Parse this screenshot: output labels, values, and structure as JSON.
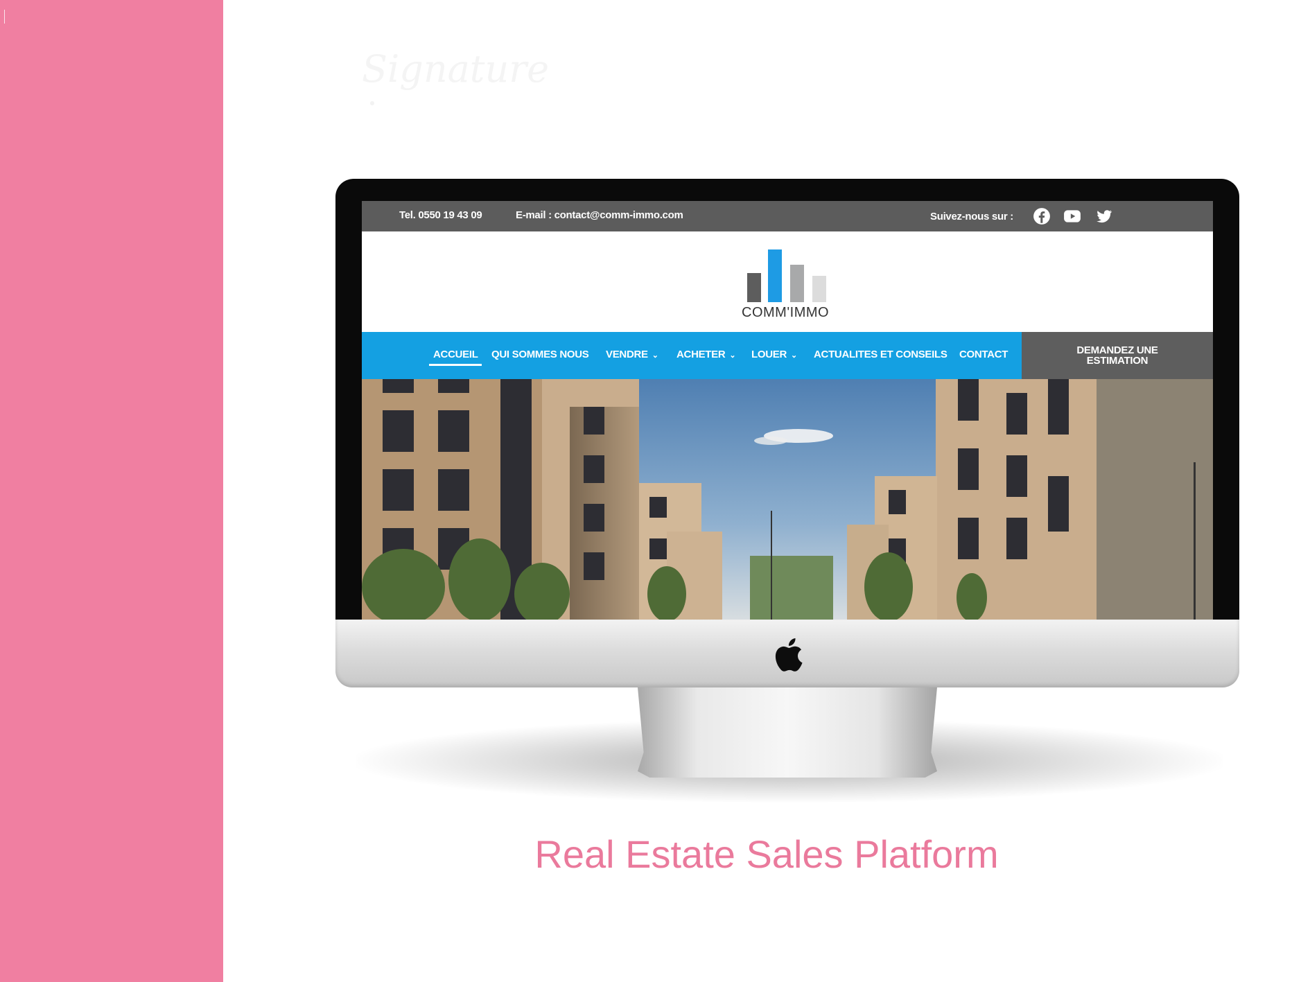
{
  "topbar": {
    "phone": "Tel. 0550 19 43 09",
    "email": "E-mail : contact@comm-immo.com",
    "follow": "Suivez-nous sur :",
    "socials": [
      "facebook-icon",
      "youtube-icon",
      "twitter-icon"
    ]
  },
  "logo": {
    "brand": "COMM'IMMO"
  },
  "nav": {
    "items": [
      {
        "label": "ACCUEIL",
        "dropdown": false,
        "active": true
      },
      {
        "label": "QUI SOMMES NOUS",
        "dropdown": false
      },
      {
        "label": "VENDRE",
        "dropdown": true
      },
      {
        "label": "ACHETER",
        "dropdown": true
      },
      {
        "label": "LOUER",
        "dropdown": true
      },
      {
        "label": "ACTUALITES ET CONSEILS",
        "dropdown": false
      },
      {
        "label": "CONTACT",
        "dropdown": false
      }
    ],
    "cta_line1": "DEMANDEZ UNE",
    "cta_line2": "ESTIMATION"
  },
  "caption": "Real Estate Sales Platform",
  "colors": {
    "sidebar": "#f07fa1",
    "nav_blue": "#14a0e2",
    "topbar_gray": "#5c5c5c",
    "caption_pink": "#ea7a9c"
  }
}
